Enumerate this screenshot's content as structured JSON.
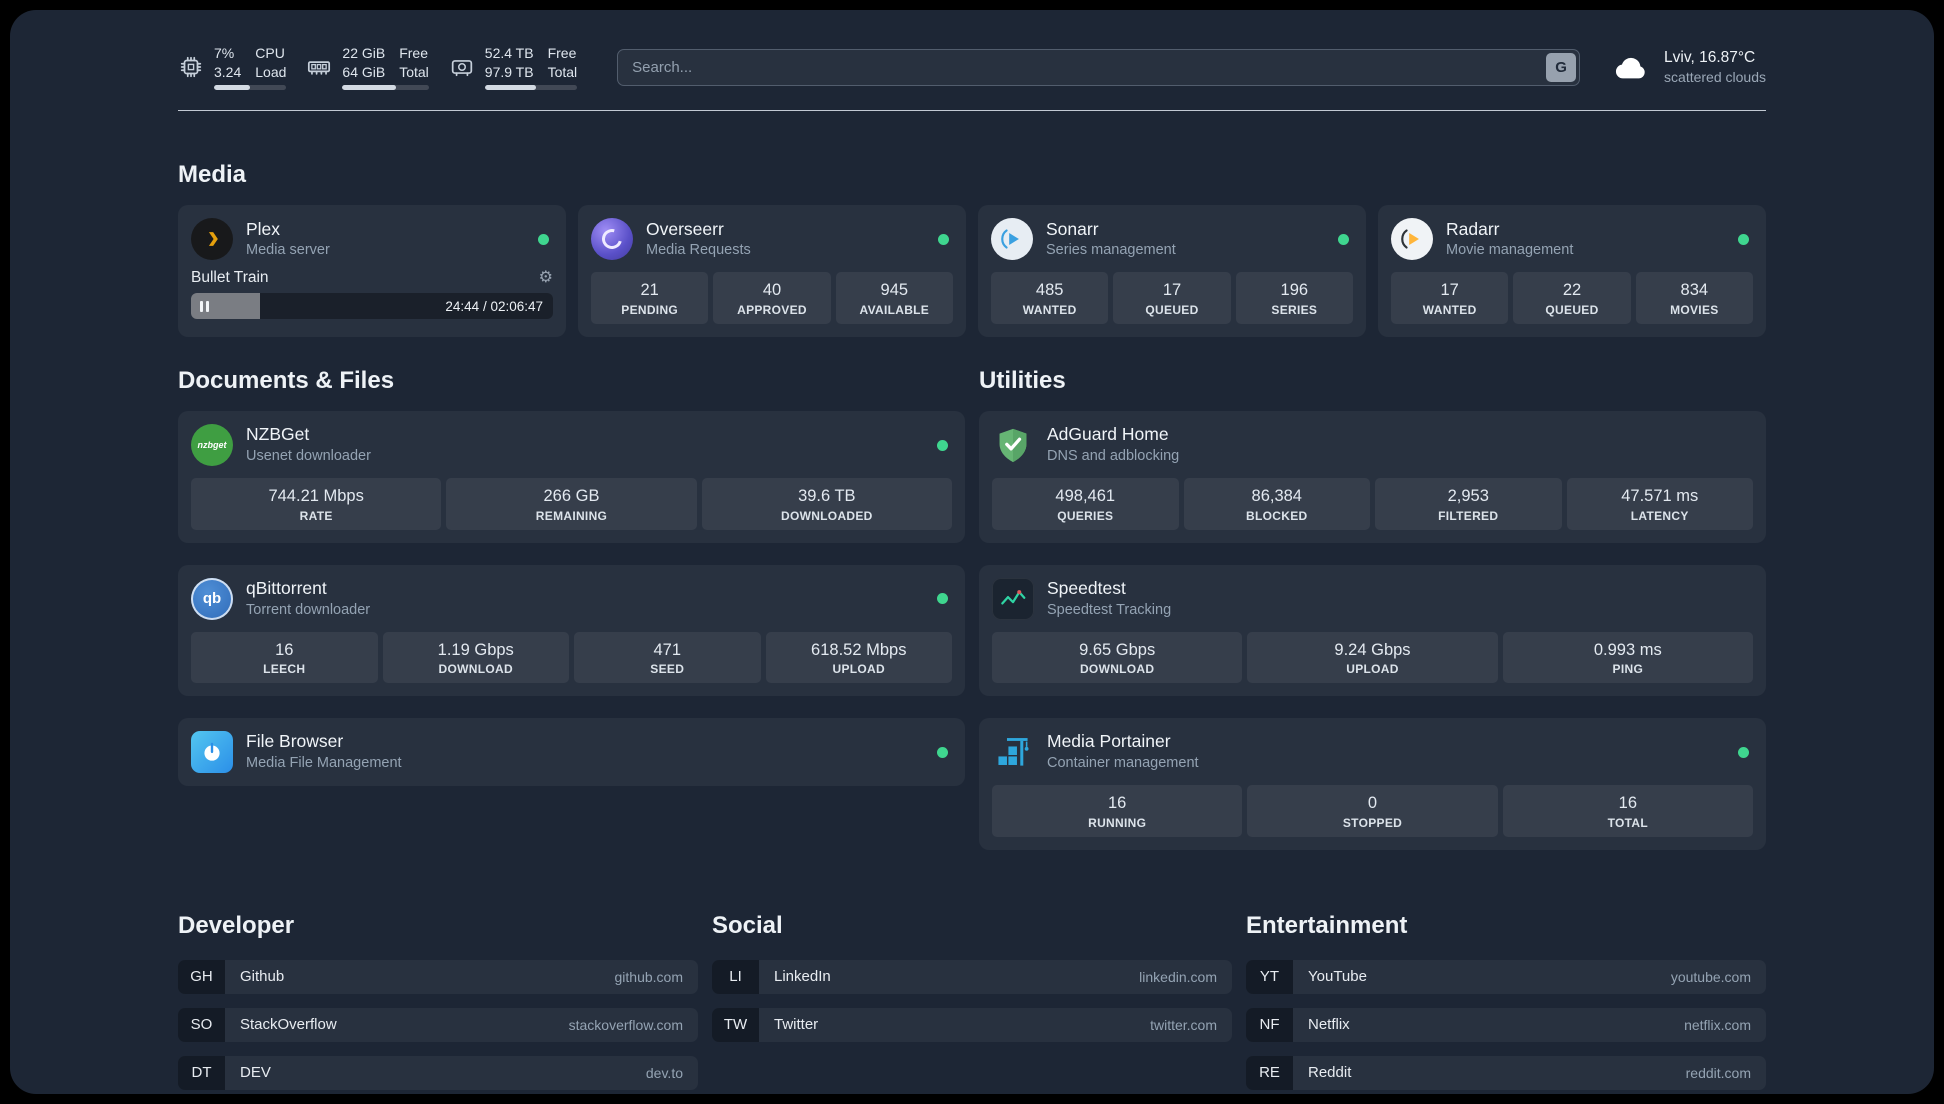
{
  "colors": {
    "background": "#1d2635",
    "card": "#2a3342",
    "status_online": "#3fd68f",
    "progress_fill": "#d3dae3"
  },
  "topbar": {
    "resources": [
      {
        "icon": "cpu-icon",
        "primary": "7%",
        "secondary": "3.24",
        "label_primary": "CPU",
        "label_secondary": "Load",
        "progress_pct": 50
      },
      {
        "icon": "memory-icon",
        "primary": "22 GiB",
        "secondary": "64 GiB",
        "label_primary": "Free",
        "label_secondary": "Total",
        "progress_pct": 62
      },
      {
        "icon": "disk-icon",
        "primary": "52.4 TB",
        "secondary": "97.9 TB",
        "label_primary": "Free",
        "label_secondary": "Total",
        "progress_pct": 55
      }
    ],
    "search": {
      "placeholder": "Search...",
      "provider_button": "G"
    },
    "weather": {
      "icon": "cloud-icon",
      "location": "Lviv, 16.87°C",
      "condition": "scattered clouds"
    }
  },
  "sections": {
    "media": {
      "title": "Media",
      "services": [
        {
          "name": "Plex",
          "subtitle": "Media server",
          "icon": "plex-icon",
          "status": "online",
          "player": {
            "track": "Bullet Train",
            "time": "24:44 / 02:06:47",
            "progress_pct": 19
          }
        },
        {
          "name": "Overseerr",
          "subtitle": "Media Requests",
          "icon": "overseerr-icon",
          "status": "online",
          "stats": [
            {
              "value": "21",
              "label": "PENDING"
            },
            {
              "value": "40",
              "label": "APPROVED"
            },
            {
              "value": "945",
              "label": "AVAILABLE"
            }
          ]
        },
        {
          "name": "Sonarr",
          "subtitle": "Series management",
          "icon": "sonarr-icon",
          "status": "online",
          "stats": [
            {
              "value": "485",
              "label": "WANTED"
            },
            {
              "value": "17",
              "label": "QUEUED"
            },
            {
              "value": "196",
              "label": "SERIES"
            }
          ]
        },
        {
          "name": "Radarr",
          "subtitle": "Movie management",
          "icon": "radarr-icon",
          "status": "online",
          "stats": [
            {
              "value": "17",
              "label": "WANTED"
            },
            {
              "value": "22",
              "label": "QUEUED"
            },
            {
              "value": "834",
              "label": "MOVIES"
            }
          ]
        }
      ]
    },
    "documents": {
      "title": "Documents & Files",
      "services": [
        {
          "name": "NZBGet",
          "subtitle": "Usenet downloader",
          "icon": "nzbget-icon",
          "icon_text": "nzbget",
          "status": "online",
          "stats": [
            {
              "value": "744.21 Mbps",
              "label": "RATE"
            },
            {
              "value": "266 GB",
              "label": "REMAINING"
            },
            {
              "value": "39.6 TB",
              "label": "DOWNLOADED"
            }
          ]
        },
        {
          "name": "qBittorrent",
          "subtitle": "Torrent downloader",
          "icon": "qbittorrent-icon",
          "icon_text": "qb",
          "status": "online",
          "stats": [
            {
              "value": "16",
              "label": "LEECH"
            },
            {
              "value": "1.19 Gbps",
              "label": "DOWNLOAD"
            },
            {
              "value": "471",
              "label": "SEED"
            },
            {
              "value": "618.52 Mbps",
              "label": "UPLOAD"
            }
          ]
        },
        {
          "name": "File Browser",
          "subtitle": "Media File Management",
          "icon": "filebrowser-icon",
          "status": "online",
          "stats": []
        }
      ]
    },
    "utilities": {
      "title": "Utilities",
      "services": [
        {
          "name": "AdGuard Home",
          "subtitle": "DNS and adblocking",
          "icon": "adguard-icon",
          "status": "online",
          "stats": [
            {
              "value": "498,461",
              "label": "QUERIES"
            },
            {
              "value": "86,384",
              "label": "BLOCKED"
            },
            {
              "value": "2,953",
              "label": "FILTERED"
            },
            {
              "value": "47.571 ms",
              "label": "LATENCY"
            }
          ]
        },
        {
          "name": "Speedtest",
          "subtitle": "Speedtest Tracking",
          "icon": "speedtest-icon",
          "status": "online",
          "stats": [
            {
              "value": "9.65 Gbps",
              "label": "DOWNLOAD"
            },
            {
              "value": "9.24 Gbps",
              "label": "UPLOAD"
            },
            {
              "value": "0.993 ms",
              "label": "PING"
            }
          ]
        },
        {
          "name": "Media Portainer",
          "subtitle": "Container management",
          "icon": "portainer-icon",
          "status": "online",
          "stats": [
            {
              "value": "16",
              "label": "RUNNING"
            },
            {
              "value": "0",
              "label": "STOPPED"
            },
            {
              "value": "16",
              "label": "TOTAL"
            }
          ]
        }
      ]
    }
  },
  "bookmarks": [
    {
      "title": "Developer",
      "items": [
        {
          "abbr": "GH",
          "name": "Github",
          "url": "github.com"
        },
        {
          "abbr": "SO",
          "name": "StackOverflow",
          "url": "stackoverflow.com"
        },
        {
          "abbr": "DT",
          "name": "DEV",
          "url": "dev.to"
        }
      ]
    },
    {
      "title": "Social",
      "items": [
        {
          "abbr": "LI",
          "name": "LinkedIn",
          "url": "linkedin.com"
        },
        {
          "abbr": "TW",
          "name": "Twitter",
          "url": "twitter.com"
        }
      ]
    },
    {
      "title": "Entertainment",
      "items": [
        {
          "abbr": "YT",
          "name": "YouTube",
          "url": "youtube.com"
        },
        {
          "abbr": "NF",
          "name": "Netflix",
          "url": "netflix.com"
        },
        {
          "abbr": "RE",
          "name": "Reddit",
          "url": "reddit.com"
        }
      ]
    }
  ]
}
